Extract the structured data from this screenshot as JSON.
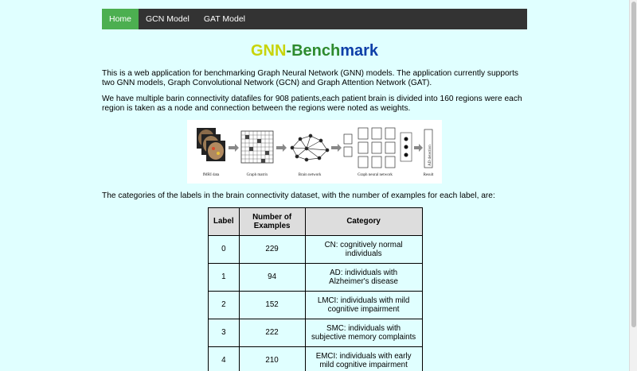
{
  "nav": {
    "items": [
      "Home",
      "GCN Model",
      "GAT Model"
    ],
    "active_color": "#4caf50",
    "bar_color": "#333333"
  },
  "title": {
    "part1": "GNN",
    "part2": "-Bench",
    "part3": "mark"
  },
  "intro": "This is a web application for benchmarking Graph Neural Network (GNN) models. The application currently supports two GNN models, Graph Convolutional Network (GCN) and Graph Attention Network (GAT).",
  "dataset_text": "We have multiple barin connectivity datafiles for 908 patients,each patient brain is divided into 160 regions were each region is taken as a node and connection between the regions were noted as weights.",
  "figure": {
    "captions": [
      "fMRI data",
      "Graph matrix",
      "Brain network",
      "Graph neural network",
      "Result"
    ],
    "side_label": "AD detection"
  },
  "categories_text": "The categories of the labels in the brain connectivity dataset, with the number of examples for each label, are:",
  "table": {
    "headers": [
      "Label",
      "Number of Examples",
      "Category"
    ],
    "rows": [
      [
        "0",
        "229",
        "CN: cognitively normal individuals"
      ],
      [
        "1",
        "94",
        "AD: individuals with Alzheimer's disease"
      ],
      [
        "2",
        "152",
        "LMCI: individuals with mild cognitive impairment"
      ],
      [
        "3",
        "222",
        "SMC: individuals with subjective memory complaints"
      ],
      [
        "4",
        "210",
        "EMCI: individuals with early mild cognitive impairment"
      ]
    ]
  },
  "background_color": "#e0ffff"
}
